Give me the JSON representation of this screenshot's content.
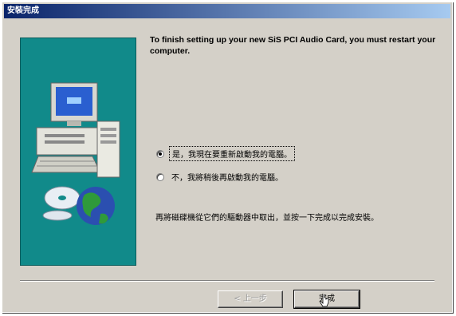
{
  "window": {
    "title": "安裝完成"
  },
  "header_text": "To finish setting up your new SiS PCI Audio Card, you must restart your computer.",
  "options": [
    {
      "label": "是，我現在要重新啟動我的電腦。",
      "checked": true,
      "focused": true
    },
    {
      "label": "不，我將稍後再啟動我的電腦。",
      "checked": false,
      "focused": false
    }
  ],
  "info_text": "再將磁碟機從它們的驅動器中取出，並按一下完成以完成安裝。",
  "buttons": {
    "back_label": "< 上一步",
    "finish_label": "完成"
  },
  "colors": {
    "panel": "#118a8a",
    "titlebar_start": "#0a246a",
    "titlebar_end": "#a6caf0",
    "dialog_bg": "#d4d0c8"
  },
  "icons": [
    "computer-icon",
    "cd-disc-icon",
    "globe-icon",
    "mouse-cursor-icon"
  ]
}
